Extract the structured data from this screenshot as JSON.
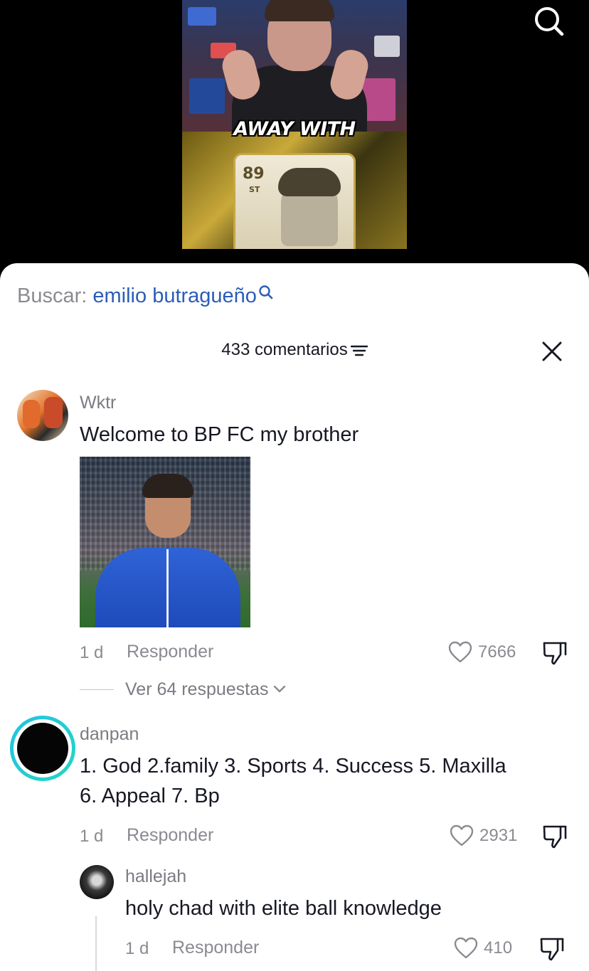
{
  "video": {
    "caption": "AWAY WITH",
    "card_rating": "89",
    "card_position": "ST"
  },
  "search_bar": {
    "label": "Buscar:",
    "query": "emilio butragueño"
  },
  "comments_header": {
    "count_label": "433 comentarios"
  },
  "comments": [
    {
      "username": "Wktr",
      "text": "Welcome to BP FC my brother",
      "time": "1 d",
      "reply_label": "Responder",
      "likes": "7666",
      "view_replies": "Ver 64 respuestas"
    },
    {
      "username": "danpan",
      "text_line1": "1. God 2.family 3. Sports 4. Success 5. Maxilla",
      "text_line2": "6. Appeal 7. Bp",
      "time": "1 d",
      "reply_label": "Responder",
      "likes": "2931"
    }
  ],
  "reply": {
    "username": "hallejah",
    "text": "holy chad with elite ball knowledge",
    "time": "1 d",
    "reply_label": "Responder",
    "likes": "410"
  },
  "colors": {
    "accent_link": "#2b5db8",
    "story_ring": "#22c3e6",
    "muted_text": "#8a8b91"
  }
}
